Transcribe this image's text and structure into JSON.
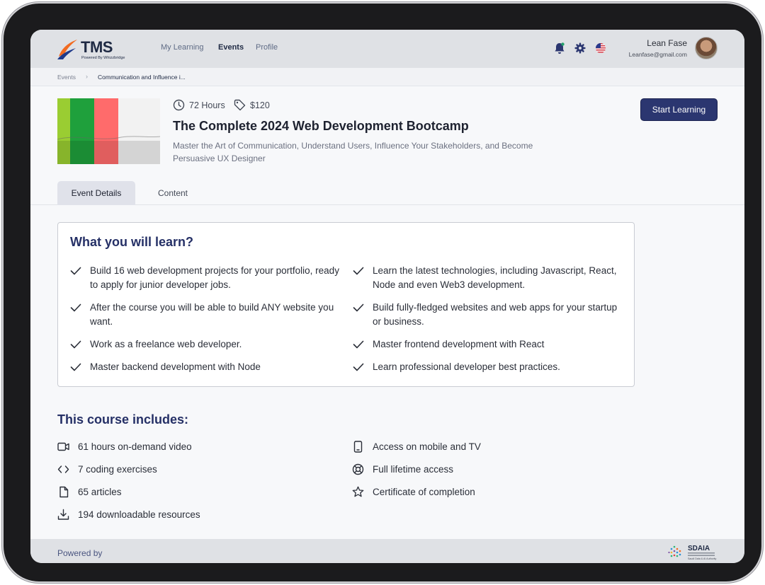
{
  "app": {
    "logo_text": "TMS",
    "logo_sub": "Powered By Whizzbridge"
  },
  "nav": {
    "items": [
      {
        "label": "My Learning"
      },
      {
        "label": "Events"
      },
      {
        "label": "Profile"
      }
    ],
    "active": "Events"
  },
  "user": {
    "name": "Lean Fase",
    "email": "Leanfase@gmail.com"
  },
  "breadcrumb": {
    "items": [
      "Events",
      "Communication and Influence i..."
    ]
  },
  "course": {
    "duration": "72 Hours",
    "price": "$120",
    "title": "The Complete 2024 Web Development Bootcamp",
    "subtitle": "Master the Art of Communication, Understand Users, Influence Your Stakeholders, and Become Persuasive UX Designer",
    "cta": "Start Learning"
  },
  "tabs": [
    {
      "label": "Event Details"
    },
    {
      "label": "Content"
    }
  ],
  "learn": {
    "title": "What you will learn?",
    "items": [
      "Build 16 web development projects for your portfolio, ready to apply for junior developer jobs.",
      "Learn the latest technologies, including Javascript, React, Node and even Web3 development.",
      "After the course you will be able to build ANY website you want.",
      "Build fully-fledged websites and web apps for your startup or business.",
      "Work as a freelance web developer.",
      "Master frontend development with React",
      "Master backend development with Node",
      "Learn professional developer best practices."
    ]
  },
  "includes": {
    "title": "This course includes:",
    "items": [
      {
        "label": "61 hours on-demand video",
        "icon": "video-icon"
      },
      {
        "label": "Access on mobile and TV",
        "icon": "mobile-icon"
      },
      {
        "label": "7 coding exercises",
        "icon": "code-icon"
      },
      {
        "label": "Full lifetime access",
        "icon": "lifebuoy-icon"
      },
      {
        "label": "65 articles",
        "icon": "file-icon"
      },
      {
        "label": "Certificate of completion",
        "icon": "star-icon"
      },
      {
        "label": "194 downloadable resources",
        "icon": "download-icon"
      }
    ]
  },
  "footer": {
    "powered_by": "Powered by",
    "partner_logo_text": "SDAIA",
    "partner_logo_sub": "Saudi Data & AI Authority"
  },
  "colors": {
    "primary": "#2b3670",
    "heading": "#253066",
    "topbar": "#dfe1e5",
    "notification": "#22a06b"
  }
}
